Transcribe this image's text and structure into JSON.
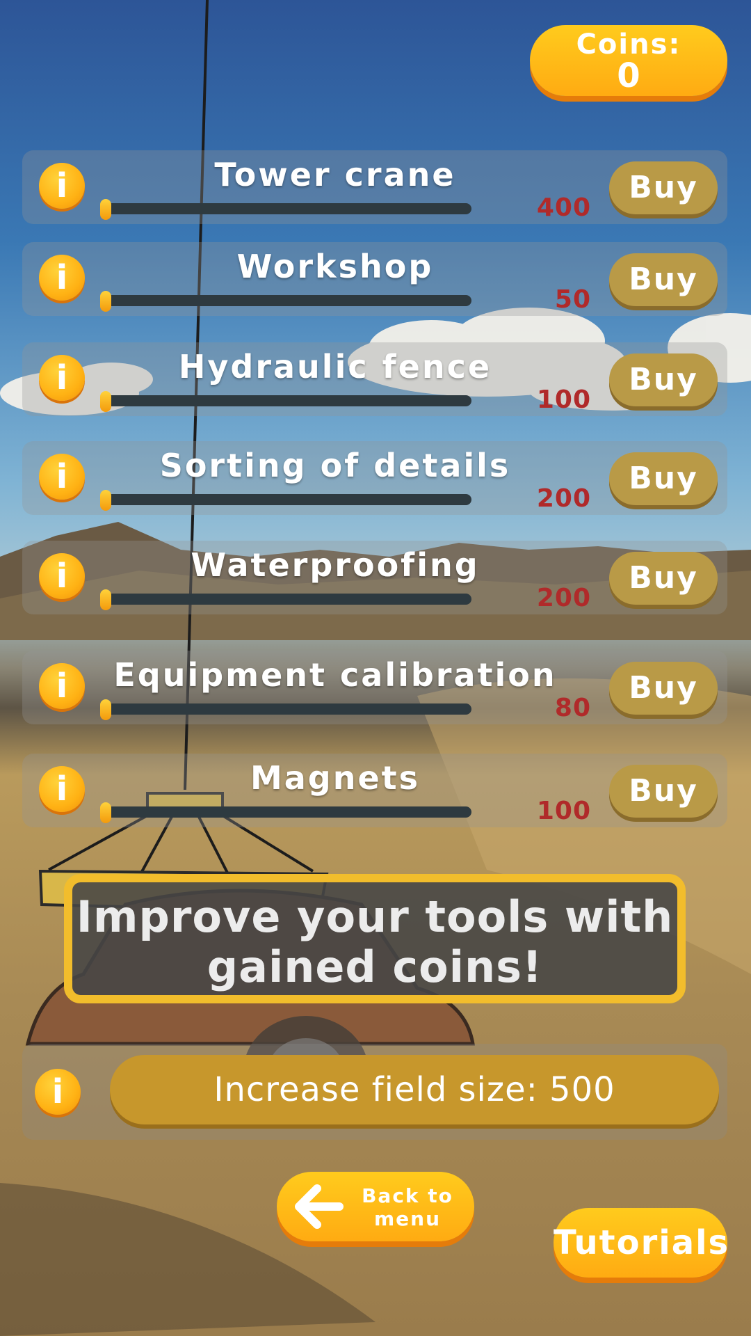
{
  "colors": {
    "accent": "#ffb214",
    "buy_button": "#b99a47",
    "price_text": "#b02a2a",
    "banner_border": "#f2bd2c"
  },
  "header": {
    "coins_label": "Coins:",
    "coins_value": "0"
  },
  "upgrades": [
    {
      "title": "Tower crane",
      "price": "400",
      "buy_label": "Buy",
      "info_icon": "info-icon",
      "level": 0
    },
    {
      "title": "Workshop",
      "price": "50",
      "buy_label": "Buy",
      "info_icon": "info-icon",
      "level": 0
    },
    {
      "title": "Hydraulic fence",
      "price": "100",
      "buy_label": "Buy",
      "info_icon": "info-icon",
      "level": 0
    },
    {
      "title": "Sorting of details",
      "price": "200",
      "buy_label": "Buy",
      "info_icon": "info-icon",
      "level": 0
    },
    {
      "title": "Waterproofing",
      "price": "200",
      "buy_label": "Buy",
      "info_icon": "info-icon",
      "level": 0
    },
    {
      "title": "Equipment calibration",
      "price": "80",
      "buy_label": "Buy",
      "info_icon": "info-icon",
      "level": 0
    },
    {
      "title": "Magnets",
      "price": "100",
      "buy_label": "Buy",
      "info_icon": "info-icon",
      "level": 0
    }
  ],
  "banner": {
    "text": "Improve your tools with gained coins!"
  },
  "field": {
    "label": "Increase field size: 500",
    "info_icon": "info-icon"
  },
  "footer": {
    "back_label": "Back to menu",
    "back_icon": "arrow-left-icon",
    "tutorials_label": "Tutorials"
  }
}
